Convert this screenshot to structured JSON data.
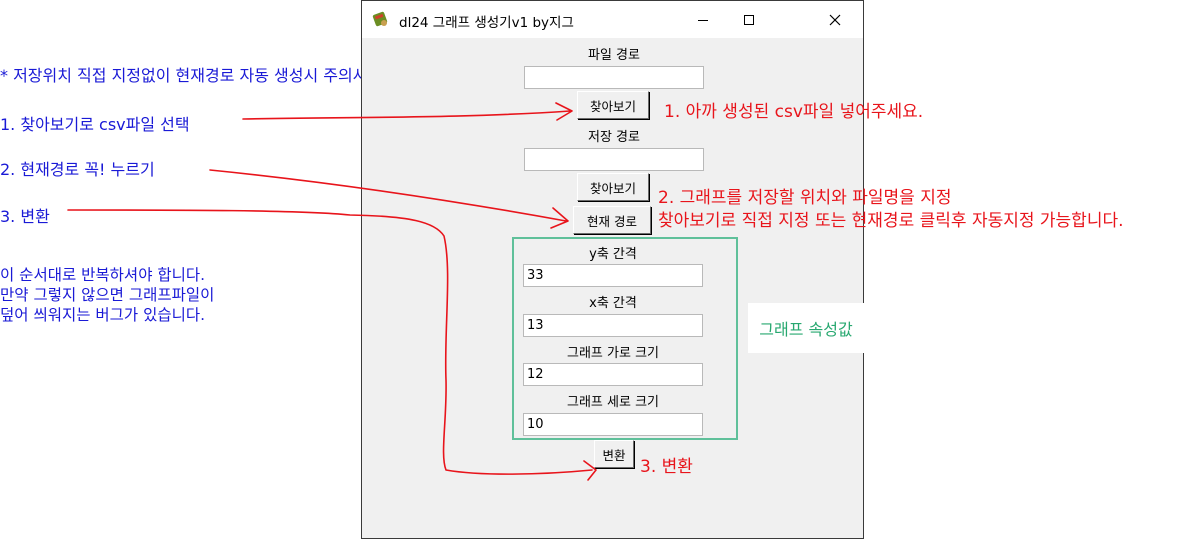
{
  "annotations": {
    "header": "* 저장위치 직접 지정없이 현재경로 자동 생성시 주의사항 *",
    "step1": "1. 찾아보기로 csv파일 선택",
    "step2": "2. 현재경로 꼭! 누르기",
    "step3": "3. 변환",
    "notes": [
      "이 순서대로 반복하셔야 합니다.",
      "만약 그렇지 않으면 그래프파일이",
      "덮어 씌워지는 버그가 있습니다."
    ],
    "red1": "1. 아까 생성된 csv파일 넣어주세요.",
    "red2_line1": "2. 그래프를 저장할 위치와 파일명을 지정",
    "red2_line2": "찾아보기로 직접 지정 또는 현재경로 클릭후 자동지정 가능합니다.",
    "red3": "3. 변환",
    "props_label": "그래프 속성값"
  },
  "window": {
    "title": "dl24 그래프 생성기v1  by지그",
    "file_path_label": "파일 경로",
    "file_path_value": "",
    "browse_label": "찾아보기",
    "save_path_label": "저장 경로",
    "save_path_value": "",
    "browse2_label": "찾아보기",
    "current_path_label": "현재 경로",
    "y_interval_label": "y축 간격",
    "y_interval_value": "33",
    "x_interval_label": "x축 간격",
    "x_interval_value": "13",
    "graph_width_label": "그래프 가로 크기",
    "graph_width_value": "12",
    "graph_height_label": "그래프 세로 크기",
    "graph_height_value": "10",
    "convert_label": "변환"
  },
  "colors": {
    "annotation_blue": "#1a1ad6",
    "annotation_red": "#e8141b",
    "group_border": "#5fc09a",
    "props_text": "#28a870"
  },
  "icons": [
    "app-icon",
    "minimize-icon",
    "maximize-icon",
    "close-icon"
  ]
}
